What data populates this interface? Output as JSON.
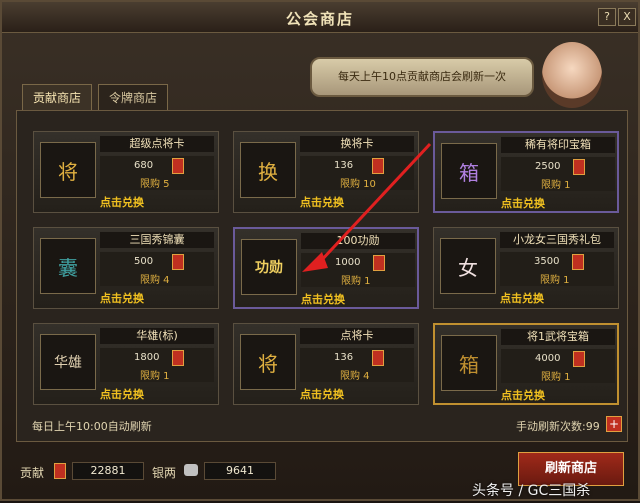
{
  "window": {
    "title": "公会商店",
    "help": "?",
    "close": "X"
  },
  "bubble_text": "每天上午10点贡献商店会刷新一次",
  "tabs": [
    {
      "label": "贡献商店"
    },
    {
      "label": "令牌商店"
    }
  ],
  "items": [
    {
      "name": "超级点将卡",
      "price": "680",
      "limit": "限购 5",
      "action": "点击兑换",
      "glyph": "将"
    },
    {
      "name": "换将卡",
      "price": "136",
      "limit": "限购 10",
      "action": "点击兑换",
      "glyph": "换"
    },
    {
      "name": "稀有将印宝箱",
      "price": "2500",
      "limit": "限购 1",
      "action": "点击兑换",
      "glyph": "箱"
    },
    {
      "name": "三国秀锦囊",
      "price": "500",
      "limit": "限购 4",
      "action": "点击兑换",
      "glyph": "囊"
    },
    {
      "name": "100功勋",
      "price": "1000",
      "limit": "限购 1",
      "action": "点击兑换",
      "glyph": "功勋"
    },
    {
      "name": "小龙女三国秀礼包",
      "price": "3500",
      "limit": "限购 1",
      "action": "点击兑换",
      "glyph": "女"
    },
    {
      "name": "华雄(标)",
      "price": "1800",
      "limit": "限购 1",
      "action": "点击兑换",
      "glyph": "华雄"
    },
    {
      "name": "点将卡",
      "price": "136",
      "limit": "限购 4",
      "action": "点击兑换",
      "glyph": "将"
    },
    {
      "name": "将1武将宝箱",
      "price": "4000",
      "limit": "限购 1",
      "action": "点击兑换",
      "glyph": "箱"
    }
  ],
  "auto_refresh": "每日上午10:00自动刷新",
  "manual_refresh": "手动刷新次数:99",
  "plus": "+",
  "currency": {
    "contrib_label": "贡献",
    "contrib_value": "22881",
    "silver_label": "银两",
    "silver_value": "9641"
  },
  "refresh_button": "刷新商店",
  "watermark": "头条号 / GC三国杀"
}
